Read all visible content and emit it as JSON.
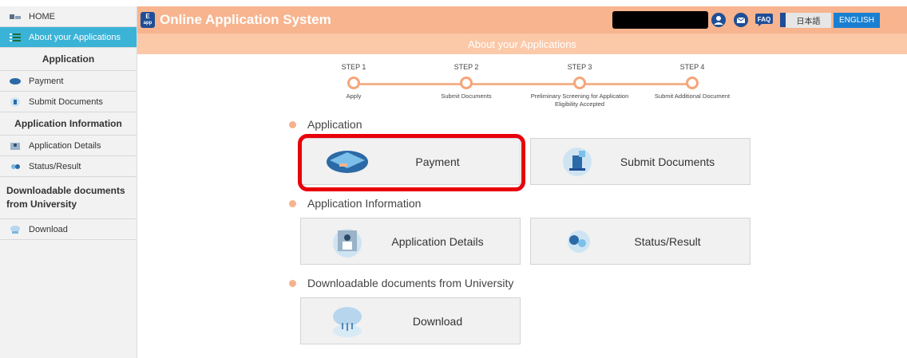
{
  "sidebar": {
    "home": "HOME",
    "about": "About your Applications",
    "application_heading": "Application",
    "payment": "Payment",
    "submit_documents": "Submit Documents",
    "app_info_heading": "Application Information",
    "application_details": "Application Details",
    "status_result": "Status/Result",
    "downloadable_heading": "Downloadable documents from University",
    "download": "Download"
  },
  "header": {
    "title": "Online Application System",
    "logo_text_top": "E",
    "logo_text_bottom": "app",
    "faq": "FAQ",
    "lang_jp": "日本語",
    "lang_en": "ENGLISH",
    "accent": "#f7b48e"
  },
  "subheader": {
    "title": "About your Applications"
  },
  "steps": [
    {
      "label": "STEP 1",
      "name": "Apply"
    },
    {
      "label": "STEP 2",
      "name": "Submit Documents"
    },
    {
      "label": "STEP 3",
      "name": "Preliminary Screening for Application Eligibility Accepted"
    },
    {
      "label": "STEP 4",
      "name": "Submit Additional Document"
    }
  ],
  "sections": {
    "application": {
      "title": "Application",
      "cards": [
        {
          "label": "Payment",
          "icon": "credit-card-icon"
        },
        {
          "label": "Submit Documents",
          "icon": "document-upload-icon"
        }
      ]
    },
    "application_information": {
      "title": "Application Information",
      "cards": [
        {
          "label": "Application Details",
          "icon": "person-details-icon"
        },
        {
          "label": "Status/Result",
          "icon": "status-icon"
        }
      ]
    },
    "downloadable": {
      "title": "Downloadable documents from University",
      "cards": [
        {
          "label": "Download",
          "icon": "cloud-download-icon"
        }
      ]
    }
  }
}
